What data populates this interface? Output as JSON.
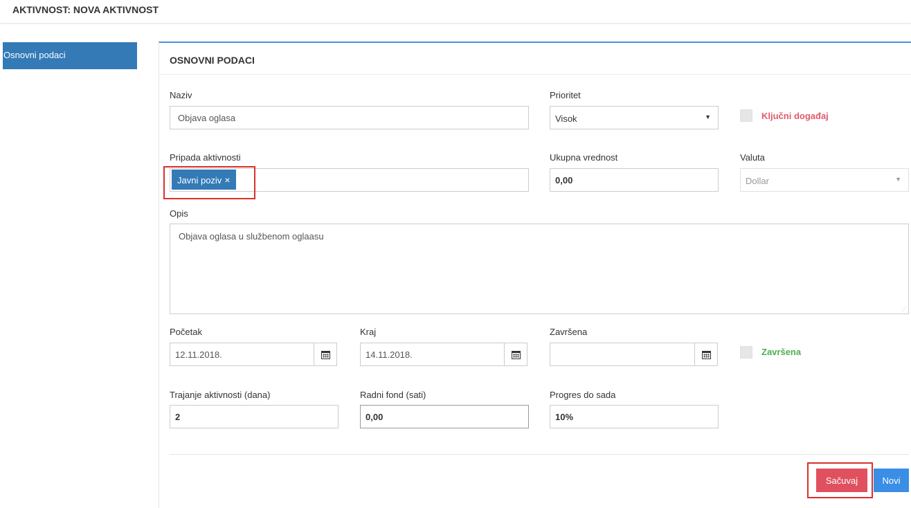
{
  "header": {
    "title": "AKTIVNOST: NOVA AKTIVNOST"
  },
  "sidebar": {
    "items": [
      {
        "label": "Osnovni podaci",
        "active": true
      }
    ]
  },
  "panel": {
    "title": "OSNOVNI PODACI"
  },
  "form": {
    "naziv": {
      "label": "Naziv",
      "value": "Objava oglasa"
    },
    "prioritet": {
      "label": "Prioritet",
      "value": "Visok"
    },
    "kljucni": {
      "label": "Ključni događaj",
      "checked": false,
      "color": "#e05a6a"
    },
    "pripada": {
      "label": "Pripada aktivnosti",
      "chip": "Javni poziv",
      "chip_remove": "×"
    },
    "ukupna": {
      "label": "Ukupna vrednost",
      "value": "0,00"
    },
    "valuta": {
      "label": "Valuta",
      "value": "Dollar",
      "disabled": true
    },
    "opis": {
      "label": "Opis",
      "value": "Objava oglasa u službenom oglaasu"
    },
    "pocetak": {
      "label": "Početak",
      "value": "12.11.2018."
    },
    "kraj": {
      "label": "Kraj",
      "value": "14.11.2018."
    },
    "zavrsena_date": {
      "label": "Završena",
      "value": ""
    },
    "zavrsena_chk": {
      "label": "Završena",
      "checked": false,
      "color": "#4caf50"
    },
    "trajanje": {
      "label": "Trajanje aktivnosti (dana)",
      "value": "2"
    },
    "radni_fond": {
      "label": "Radni fond (sati)",
      "value": "0,00"
    },
    "progres": {
      "label": "Progres do sada",
      "value": "10%"
    }
  },
  "actions": {
    "save_label": "Sačuvaj",
    "new_label": "Novi"
  },
  "icons": {
    "calendar": "calendar-icon",
    "dropdown": "caret-down-icon"
  },
  "colors": {
    "accent": "#337ab7",
    "danger": "#e0505f",
    "primary_btn": "#3a8ee6",
    "highlight": "#d9302a"
  }
}
